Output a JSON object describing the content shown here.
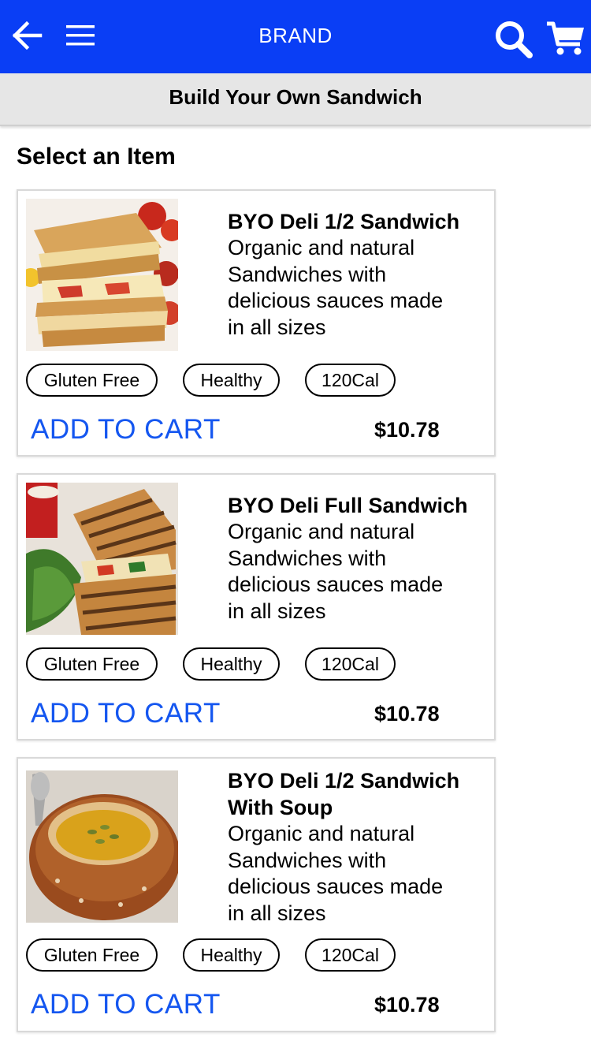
{
  "header": {
    "brand": "BRAND",
    "color": "#0a3ef5",
    "icons": [
      "back-arrow-icon",
      "hamburger-menu-icon",
      "search-icon",
      "cart-icon"
    ]
  },
  "subheader": {
    "title": "Build Your Own Sandwich"
  },
  "section": {
    "title": "Select an Item"
  },
  "items": [
    {
      "name": "BYO Deli 1/2 Sandwich",
      "desc_lines": [
        "Organic and natural",
        "Sandwiches with",
        "delicious sauces made",
        "in all sizes"
      ],
      "tags": [
        "Gluten Free",
        "Healthy",
        "120Cal"
      ],
      "add_label": "ADD TO CART",
      "price": "$10.78",
      "image": "grilled-cheese-sandwich-photo"
    },
    {
      "name": "BYO Deli Full Sandwich",
      "desc_lines": [
        "Organic and natural",
        "Sandwiches with",
        "delicious sauces made",
        "in all sizes"
      ],
      "tags": [
        "Gluten Free",
        "Healthy",
        "120Cal"
      ],
      "add_label": "ADD TO CART",
      "price": "$10.78",
      "image": "panini-sandwich-photo"
    },
    {
      "name_lines": [
        "BYO Deli 1/2 Sandwich",
        "With Soup"
      ],
      "desc_lines": [
        "Organic and natural",
        "Sandwiches with",
        "delicious sauces made",
        "in all sizes"
      ],
      "tags": [
        "Gluten Free",
        "Healthy",
        "120Cal"
      ],
      "add_label": "ADD TO CART",
      "price": "$10.78",
      "image": "soup-bread-bowl-photo"
    }
  ],
  "colors": {
    "accent": "#1456f0",
    "header": "#0a3ef5",
    "subheader_bg": "#e6e6e6"
  }
}
